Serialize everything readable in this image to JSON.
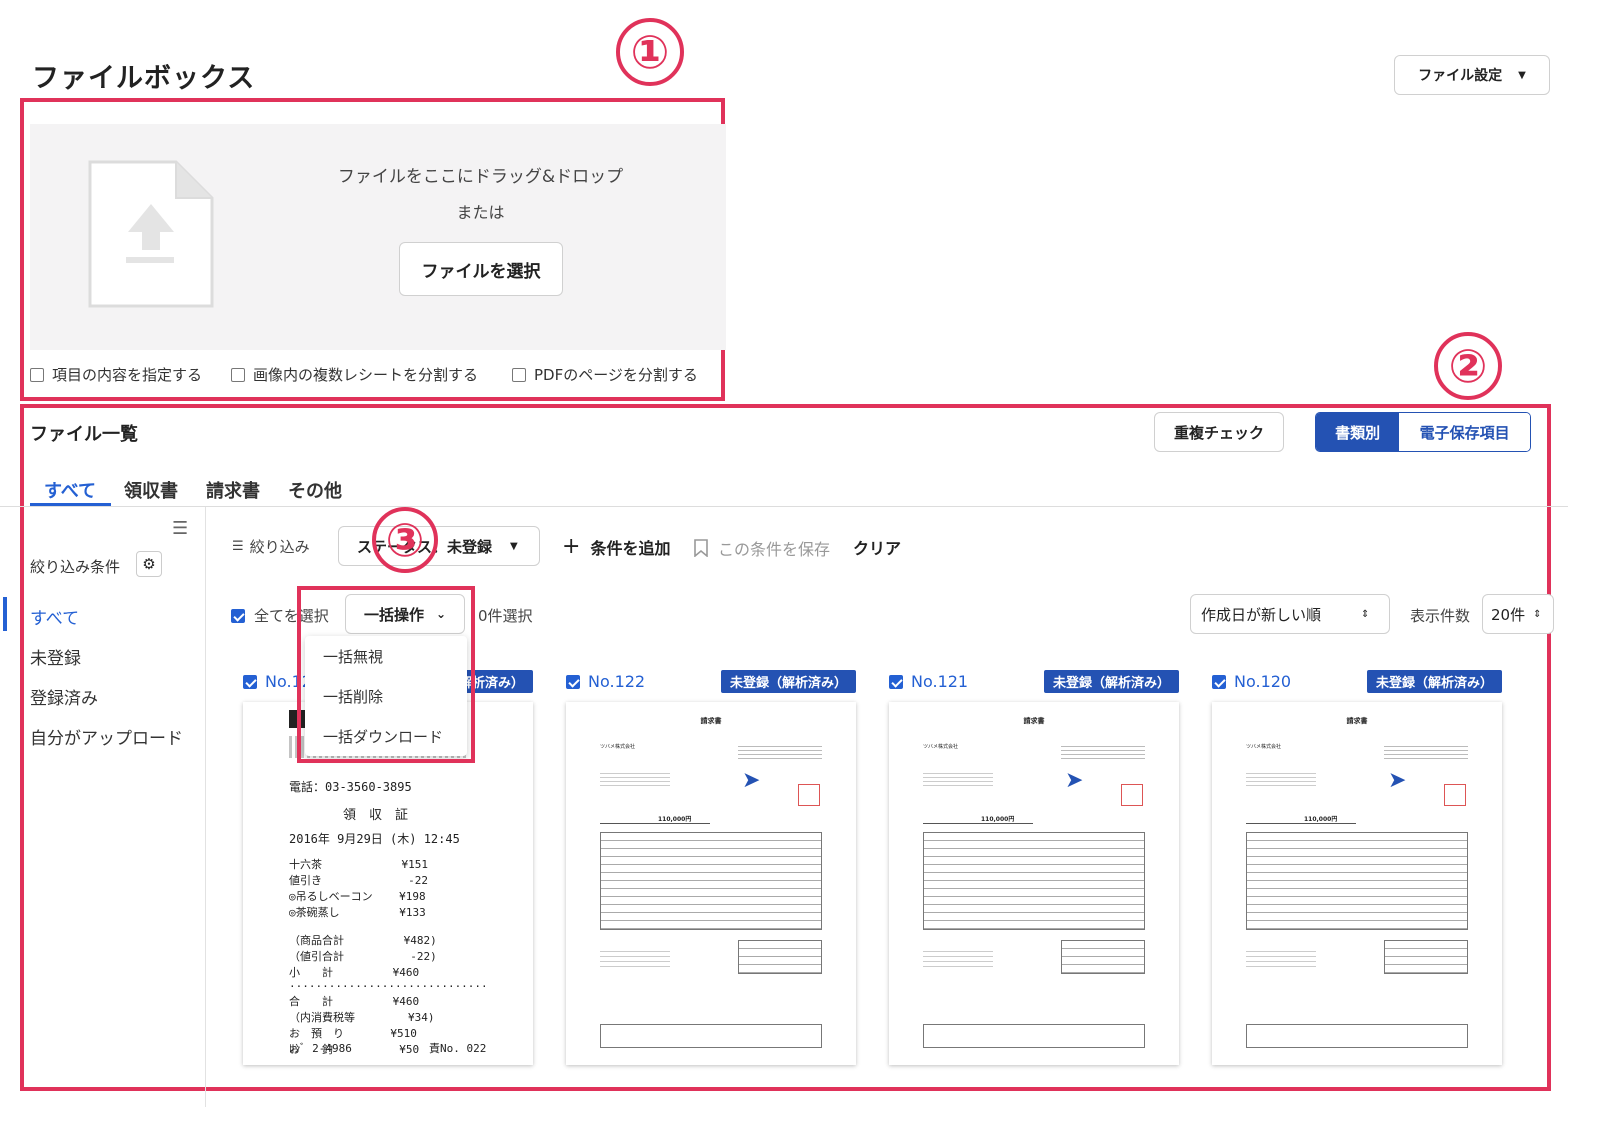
{
  "header": {
    "title": "ファイルボックス",
    "settings_button": "ファイル設定"
  },
  "annotations": {
    "one": "①",
    "two": "②",
    "three": "③"
  },
  "upload": {
    "drag_text": "ファイルをここにドラッグ&ドロップ",
    "or_text": "または",
    "select_button": "ファイルを選択",
    "options": [
      "項目の内容を指定する",
      "画像内の複数レシートを分割する",
      "PDFのページを分割する"
    ]
  },
  "list": {
    "title": "ファイル一覧",
    "duplicate_check": "重複チェック",
    "view_toggle": [
      "書類別",
      "電子保存項目"
    ],
    "tabs": [
      "すべて",
      "領収書",
      "請求書",
      "その他"
    ]
  },
  "sidebar": {
    "filter_label": "絞り込み条件",
    "items": [
      "すべて",
      "未登録",
      "登録済み",
      "自分がアップロード"
    ]
  },
  "filter_bar": {
    "filter": "絞り込み",
    "status_select": "ステータス：未登録",
    "add_condition": "条件を追加",
    "save_condition": "この条件を保存",
    "clear": "クリア"
  },
  "bulk": {
    "select_all": "全てを選択",
    "bulk_button": "一括操作",
    "selected_count": "0件選択",
    "menu": [
      "一括無視",
      "一括削除",
      "一括ダウンロード"
    ],
    "sort_select": "作成日が新しい順",
    "per_page_label": "表示件数",
    "per_page_select": "20件"
  },
  "cards": [
    {
      "no": "No.123",
      "badge": "未登録（解析済み）"
    },
    {
      "no": "No.122",
      "badge": "未登録（解析済み）"
    },
    {
      "no": "No.121",
      "badge": "未登録（解析済み）"
    },
    {
      "no": "No.120",
      "badge": "未登録（解析済み）"
    }
  ],
  "receipt": {
    "phone": "電話：03-3560-3895",
    "heading": "領　収　証",
    "date": "2016年 9月29日 (木) 12:45",
    "lines": [
      "十六茶            ¥151",
      "値引き             -22",
      "◎吊るしベーコン    ¥198",
      "◎茶碗蒸し         ¥133",
      "",
      "（商品合計         ¥482)",
      "（値引合計          -22)",
      "小　　計         ¥460",
      "······························",
      "合　　計         ¥460",
      "（内消費税等        ¥34)",
      "お　預　り       ¥510",
      "お　　釣          ¥50"
    ],
    "footer_left": "ﾚｼﾞ 2-4986",
    "footer_right": "責No. 022"
  },
  "invoice": {
    "title": "請求書",
    "company": "ツバメ株式会社",
    "amount": "110,000円"
  }
}
